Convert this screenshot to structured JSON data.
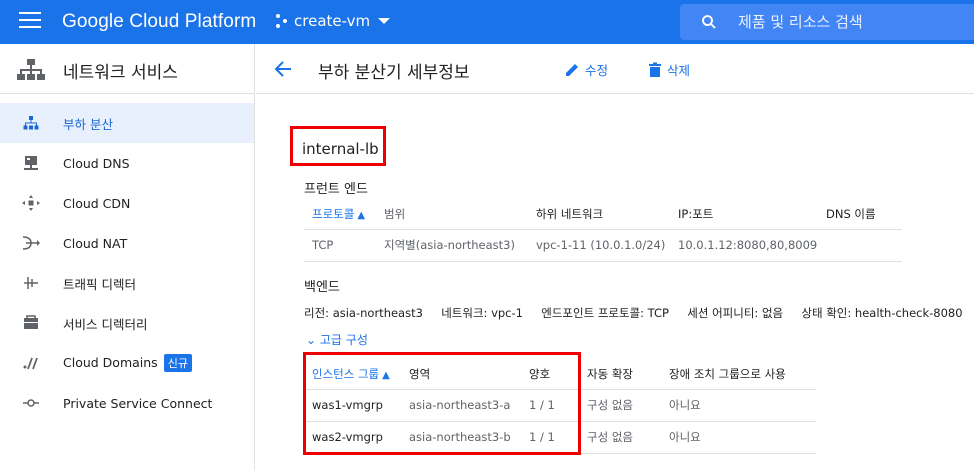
{
  "topbar": {
    "brand": "Google Cloud Platform",
    "project": "create-vm",
    "search_placeholder": "제품 및 리소스 검색"
  },
  "leftnav": {
    "title": "네트워크 서비스",
    "items": [
      {
        "label": "부하 분산",
        "icon": "load-balancing-icon",
        "active": true
      },
      {
        "label": "Cloud DNS",
        "icon": "dns-icon"
      },
      {
        "label": "Cloud CDN",
        "icon": "cdn-icon"
      },
      {
        "label": "Cloud NAT",
        "icon": "nat-icon"
      },
      {
        "label": "트래픽 디렉터",
        "icon": "traffic-director-icon"
      },
      {
        "label": "서비스 디렉터리",
        "icon": "service-directory-icon"
      },
      {
        "label": "Cloud Domains",
        "icon": "domains-icon",
        "badge": "신규"
      },
      {
        "label": "Private Service Connect",
        "icon": "private-service-connect-icon"
      }
    ]
  },
  "header": {
    "title": "부하 분산기 세부정보",
    "edit_label": "수정",
    "delete_label": "삭제"
  },
  "lb": {
    "name": "internal-lb",
    "frontend_title": "프런트 엔드",
    "frontend": {
      "columns": [
        "프로토콜",
        "범위",
        "하위 네트워크",
        "IP:포트",
        "DNS 이름"
      ],
      "rows": [
        [
          "TCP",
          "지역별(asia-northeast3)",
          "vpc-1-11 (10.0.1.0/24)",
          "10.0.1.12:8080,80,8009",
          ""
        ]
      ]
    },
    "backend_title": "백엔드",
    "backend_meta": {
      "region_label": "리전:",
      "region": "asia-northeast3",
      "network_label": "네트워크:",
      "network": "vpc-1",
      "endpoint_label": "엔드포인트 프로토콜:",
      "endpoint": "TCP",
      "affinity_label": "세션 어피니티:",
      "affinity": "없음",
      "health_label": "상태 확인:",
      "health": "health-check-8080"
    },
    "advanced_label": "고급 구성",
    "backend": {
      "columns": [
        "인스턴스 그룹",
        "영역",
        "양호",
        "자동 확장",
        "장애 조치 그룹으로 사용"
      ],
      "rows": [
        [
          "was1-vmgrp",
          "asia-northeast3-a",
          "1 / 1",
          "구성 없음",
          "아니요"
        ],
        [
          "was2-vmgrp",
          "asia-northeast3-b",
          "1 / 1",
          "구성 없음",
          "아니요"
        ]
      ]
    }
  }
}
